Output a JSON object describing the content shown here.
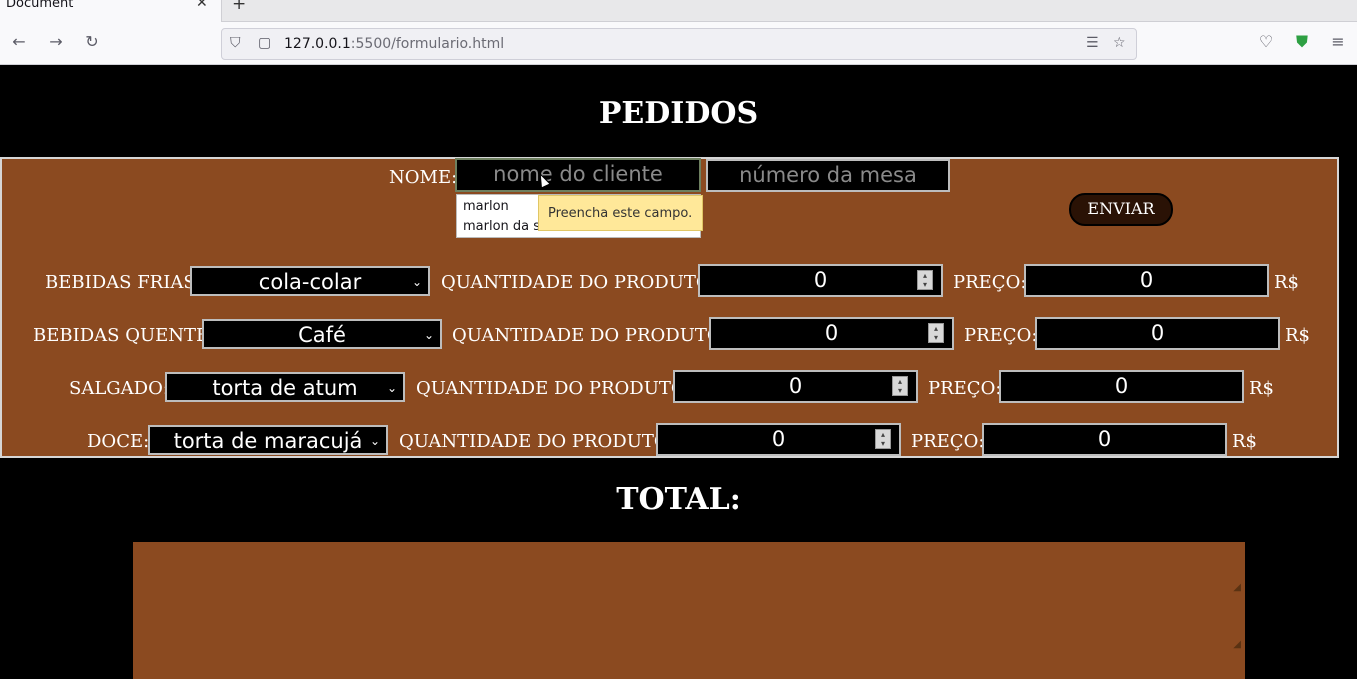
{
  "browser": {
    "tab_title": "Document",
    "tab_close": "✕",
    "new_tab": "+",
    "url_host": "127.0.0.1",
    "url_rest": ":5500/formulario.html"
  },
  "page": {
    "title": "PEDIDOS",
    "name_label": "NOME:",
    "name_placeholder": "nome do cliente",
    "table_placeholder": "número da mesa",
    "submit_label": "ENVIAR",
    "autocomplete": [
      "marlon",
      "marlon da s"
    ],
    "validation_tooltip": "Preencha este campo.",
    "qty_label": "QUANTIDADE DO PRODUTO:",
    "price_label": "PREÇO:",
    "currency": "R$",
    "rows": [
      {
        "label": "BEBIDAS FRIAS:",
        "selected": "cola-colar",
        "quantity": "0",
        "price": "0"
      },
      {
        "label": "BEBIDAS QUENTE:",
        "selected": "Café",
        "quantity": "0",
        "price": "0"
      },
      {
        "label": "SALGADO:",
        "selected": "torta de atum",
        "quantity": "0",
        "price": "0"
      },
      {
        "label": "DOCE:",
        "selected": "torta de maracujá",
        "quantity": "0",
        "price": "0"
      }
    ],
    "total_label": "TOTAL:"
  },
  "colors": {
    "form_bg": "#8b4a20",
    "page_bg": "#000000",
    "tooltip_bg": "#ffe899"
  }
}
